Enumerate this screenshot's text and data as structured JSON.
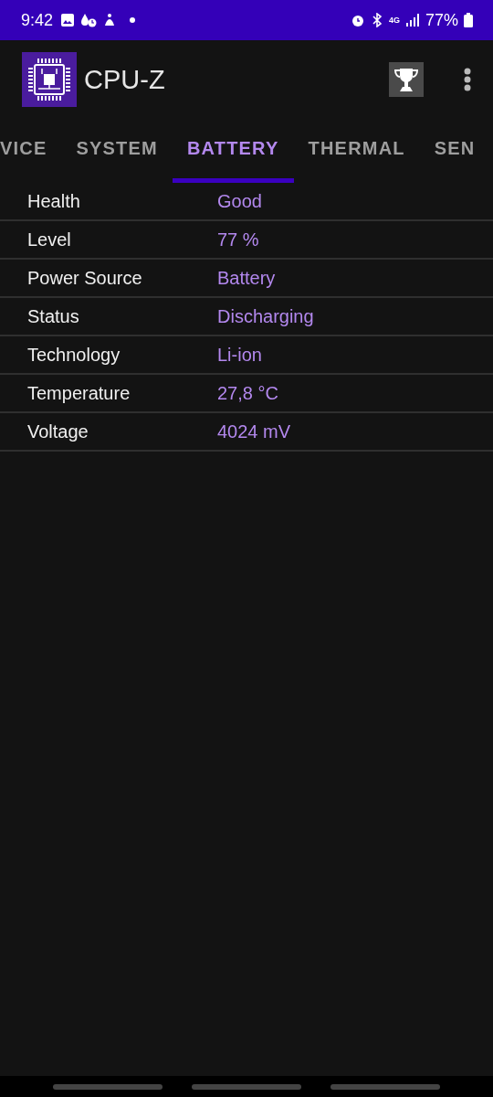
{
  "status_bar": {
    "time": "9:42",
    "network_type": "4G",
    "battery": "77%"
  },
  "app_bar": {
    "title": "CPU-Z"
  },
  "tabs": [
    {
      "label": "VICE",
      "selected": false
    },
    {
      "label": "SYSTEM",
      "selected": false
    },
    {
      "label": "BATTERY",
      "selected": true
    },
    {
      "label": "THERMAL",
      "selected": false
    },
    {
      "label": "SEN",
      "selected": false
    }
  ],
  "rows": [
    {
      "label": "Health",
      "value": "Good"
    },
    {
      "label": "Level",
      "value": "77 %"
    },
    {
      "label": "Power Source",
      "value": "Battery"
    },
    {
      "label": "Status",
      "value": "Discharging"
    },
    {
      "label": "Technology",
      "value": "Li-ion"
    },
    {
      "label": "Temperature",
      "value": "27,8 °C"
    },
    {
      "label": "Voltage",
      "value": "4024 mV"
    }
  ]
}
